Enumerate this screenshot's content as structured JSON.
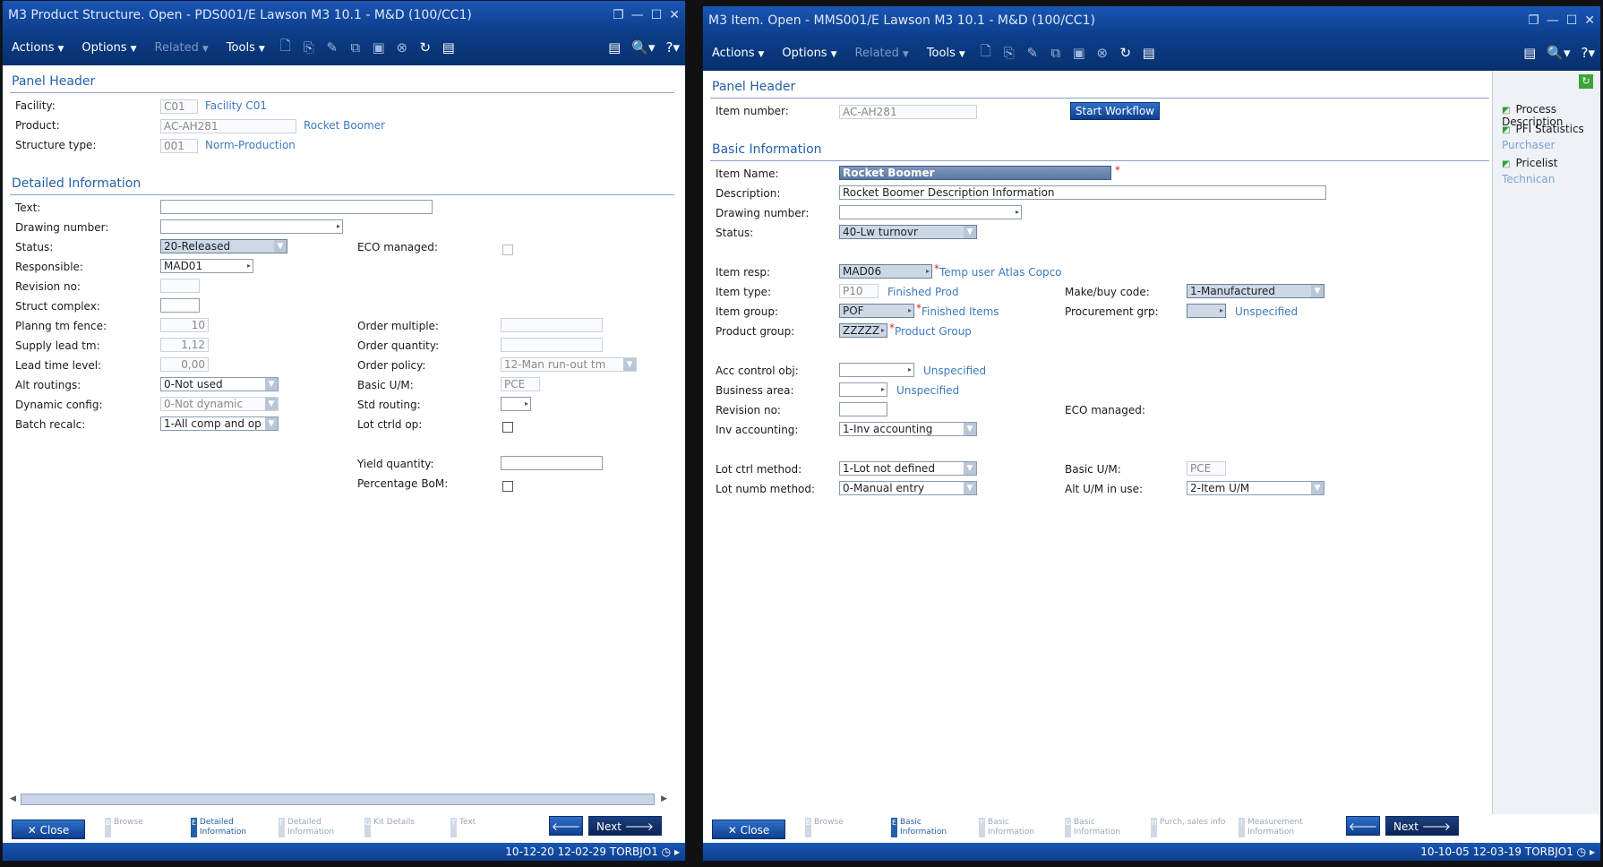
{
  "left": {
    "title": "M3 Product Structure. Open - PDS001/E   Lawson M3 10.1  - M&D  (100/CC1)",
    "menu": {
      "actions": "Actions",
      "options": "Options",
      "related": "Related",
      "tools": "Tools"
    },
    "panel_header": "Panel Header",
    "facility_label": "Facility:",
    "facility_value": "C01",
    "facility_desc": "Facility C01",
    "product_label": "Product:",
    "product_value": "AC-AH281",
    "product_desc": "Rocket Boomer",
    "structure_label": "Structure type:",
    "structure_value": "001",
    "structure_desc": "Norm-Production",
    "detailed_header": "Detailed Information",
    "text_label": "Text:",
    "drawing_label": "Drawing number:",
    "status_label": "Status:",
    "status_value": "20-Released",
    "eco_label": "ECO managed:",
    "responsible_label": "Responsible:",
    "responsible_value": "MAD01",
    "revision_label": "Revision no:",
    "struct_complex_label": "Struct complex:",
    "planng_label": "Planng tm fence:",
    "planng_value": "10",
    "order_multiple_label": "Order multiple:",
    "supply_label": "Supply lead tm:",
    "supply_value": "1,12",
    "order_qty_label": "Order quantity:",
    "lead_label": "Lead time level:",
    "lead_value": "0,00",
    "order_policy_label": "Order policy:",
    "order_policy_value": "12-Man run-out tm",
    "alt_label": "Alt routings:",
    "alt_value": "0-Not used",
    "basic_um_label": "Basic U/M:",
    "basic_um_value": "PCE",
    "dyn_label": "Dynamic config:",
    "dyn_value": "0-Not dynamic",
    "std_routing_label": "Std routing:",
    "batch_label": "Batch recalc:",
    "batch_value": "1-All comp and op",
    "lot_ctrld_label": "Lot ctrld op:",
    "yield_label": "Yield quantity:",
    "pct_bom_label": "Percentage BoM:",
    "close": "Close",
    "next": "Next",
    "tabs": [
      {
        "k": "B",
        "label": "Browse"
      },
      {
        "k": "E",
        "label": "Detailed Information"
      },
      {
        "k": "F",
        "label": "Detailed Information"
      },
      {
        "k": "G",
        "label": "Kit Details"
      },
      {
        "k": "T",
        "label": "Text"
      }
    ],
    "status": "10-12-20 12-02-29 TORBJO1"
  },
  "right": {
    "title": "M3 Item. Open - MMS001/E   Lawson M3 10.1  - M&D  (100/CC1)",
    "menu": {
      "actions": "Actions",
      "options": "Options",
      "related": "Related",
      "tools": "Tools"
    },
    "panel_header": "Panel Header",
    "item_number_label": "Item number:",
    "item_number_value": "AC-AH281",
    "start_workflow": "Start Workflow",
    "basic_header": "Basic Information",
    "item_name_label": "Item Name:",
    "item_name_value": "Rocket Boomer",
    "desc_label": "Description:",
    "desc_value": "Rocket Boomer Description Information",
    "drawing_label": "Drawing number:",
    "status_label": "Status:",
    "status_value": "40-Lw turnovr",
    "item_resp_label": "Item resp:",
    "item_resp_value": "MAD06",
    "item_resp_desc": "Temp user Atlas Copco",
    "item_type_label": "Item type:",
    "item_type_value": "P10",
    "item_type_desc": "Finished Prod",
    "make_buy_label": "Make/buy code:",
    "make_buy_value": "1-Manufactured",
    "item_group_label": "Item group:",
    "item_group_value": "POF",
    "item_group_desc": "Finished Items",
    "procurement_label": "Procurement grp:",
    "procurement_desc": "Unspecified",
    "product_group_label": "Product group:",
    "product_group_value": "ZZZZZ",
    "product_group_desc": "Product Group",
    "acc_label": "Acc control obj:",
    "acc_desc": "Unspecified",
    "business_label": "Business area:",
    "business_desc": "Unspecified",
    "revision_label": "Revision no:",
    "eco_label": "ECO managed:",
    "inv_label": "Inv accounting:",
    "inv_value": "1-Inv accounting",
    "lot_ctrl_label": "Lot ctrl method:",
    "lot_ctrl_value": "1-Lot not defined",
    "basic_um_label": "Basic U/M:",
    "basic_um_value": "PCE",
    "lot_numb_label": "Lot numb method:",
    "lot_numb_value": "0-Manual entry",
    "alt_um_label": "Alt U/M in use:",
    "alt_um_value": "2-Item U/M",
    "side": {
      "process": "Process Description",
      "pfi": "PFI Statistics",
      "purchaser": "Purchaser",
      "pricelist": "Pricelist",
      "technican": "Technican"
    },
    "close": "Close",
    "next": "Next",
    "tabs": [
      {
        "k": "B",
        "label": "Browse"
      },
      {
        "k": "E",
        "label": "Basic Information"
      },
      {
        "k": "F",
        "label": "Basic Information"
      },
      {
        "k": "G",
        "label": "Basic Information"
      },
      {
        "k": "H",
        "label": "Purch, sales info"
      },
      {
        "k": "I",
        "label": "Measurement Information"
      }
    ],
    "status": "10-10-05 12-03-19 TORBJO1"
  }
}
